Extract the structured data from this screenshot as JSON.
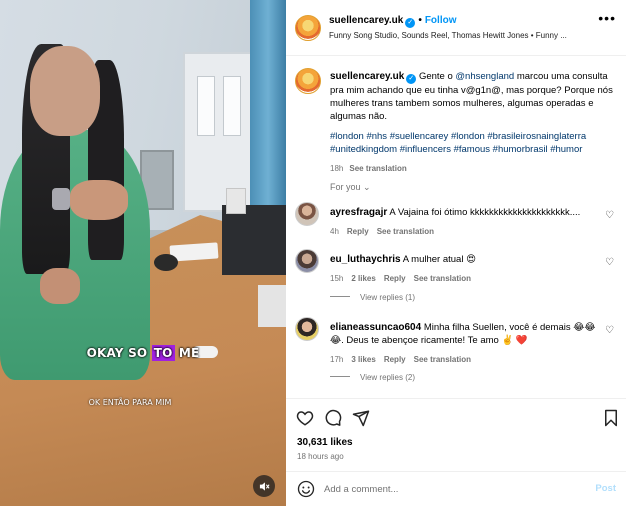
{
  "video": {
    "caption_before": "OKAY SO ",
    "caption_highlight": "TO",
    "caption_after": " ME",
    "subtitle": "OK ENTÃO PARA MIM",
    "mute_icon": "speaker-muted-icon"
  },
  "header": {
    "username": "suellencarey.uk",
    "follow_label": "Follow",
    "audio": "Funny Song Studio, Sounds Reel, Thomas Hewitt Jones • Funny ...",
    "more_label": "•••"
  },
  "post": {
    "username": "suellencarey.uk",
    "text_before": "Gente o ",
    "mention": "@nhsengland",
    "text_after": " marcou uma consulta pra mim achando que eu tinha v@g1n@, mas porque? Porque nós mulheres trans tambem somos mulheres, algumas operadas e algumas não.",
    "hashtags": "#london #nhs #suellencarey #london #brasileirosnainglaterra #unitedkingdom #influencers #famous #humorbrasil #humor",
    "time": "18h",
    "see_translation": "See translation"
  },
  "for_you_label": "For you",
  "comments": [
    {
      "username": "ayresfragajr",
      "text": "A Vajaina foi ótimo kkkkkkkkkkkkkkkkkkkkk....",
      "time": "4h",
      "likes": "",
      "reply": "Reply",
      "see_translation": "See translation",
      "view_replies": ""
    },
    {
      "username": "eu_luthaychris",
      "text": "A mulher atual 😍",
      "time": "15h",
      "likes": "2 likes",
      "reply": "Reply",
      "see_translation": "See translation",
      "view_replies": "View replies (1)"
    },
    {
      "username": "elianeassuncao604",
      "text": "Minha filha Suellen, você é demais 😂😂😂. Deus te abençoe ricamente! Te amo ✌️ ❤️",
      "time": "17h",
      "likes": "3 likes",
      "reply": "Reply",
      "see_translation": "See translation",
      "view_replies": "View replies (2)"
    }
  ],
  "actions": {
    "likes": "30,631 likes",
    "time_ago": "18 hours ago",
    "add_comment_placeholder": "Add a comment...",
    "post_label": "Post"
  },
  "colors": {
    "link_blue": "#0095f6",
    "mention_blue": "#00376b",
    "caption_highlight": "#a020e0",
    "muted_text": "#737373"
  }
}
